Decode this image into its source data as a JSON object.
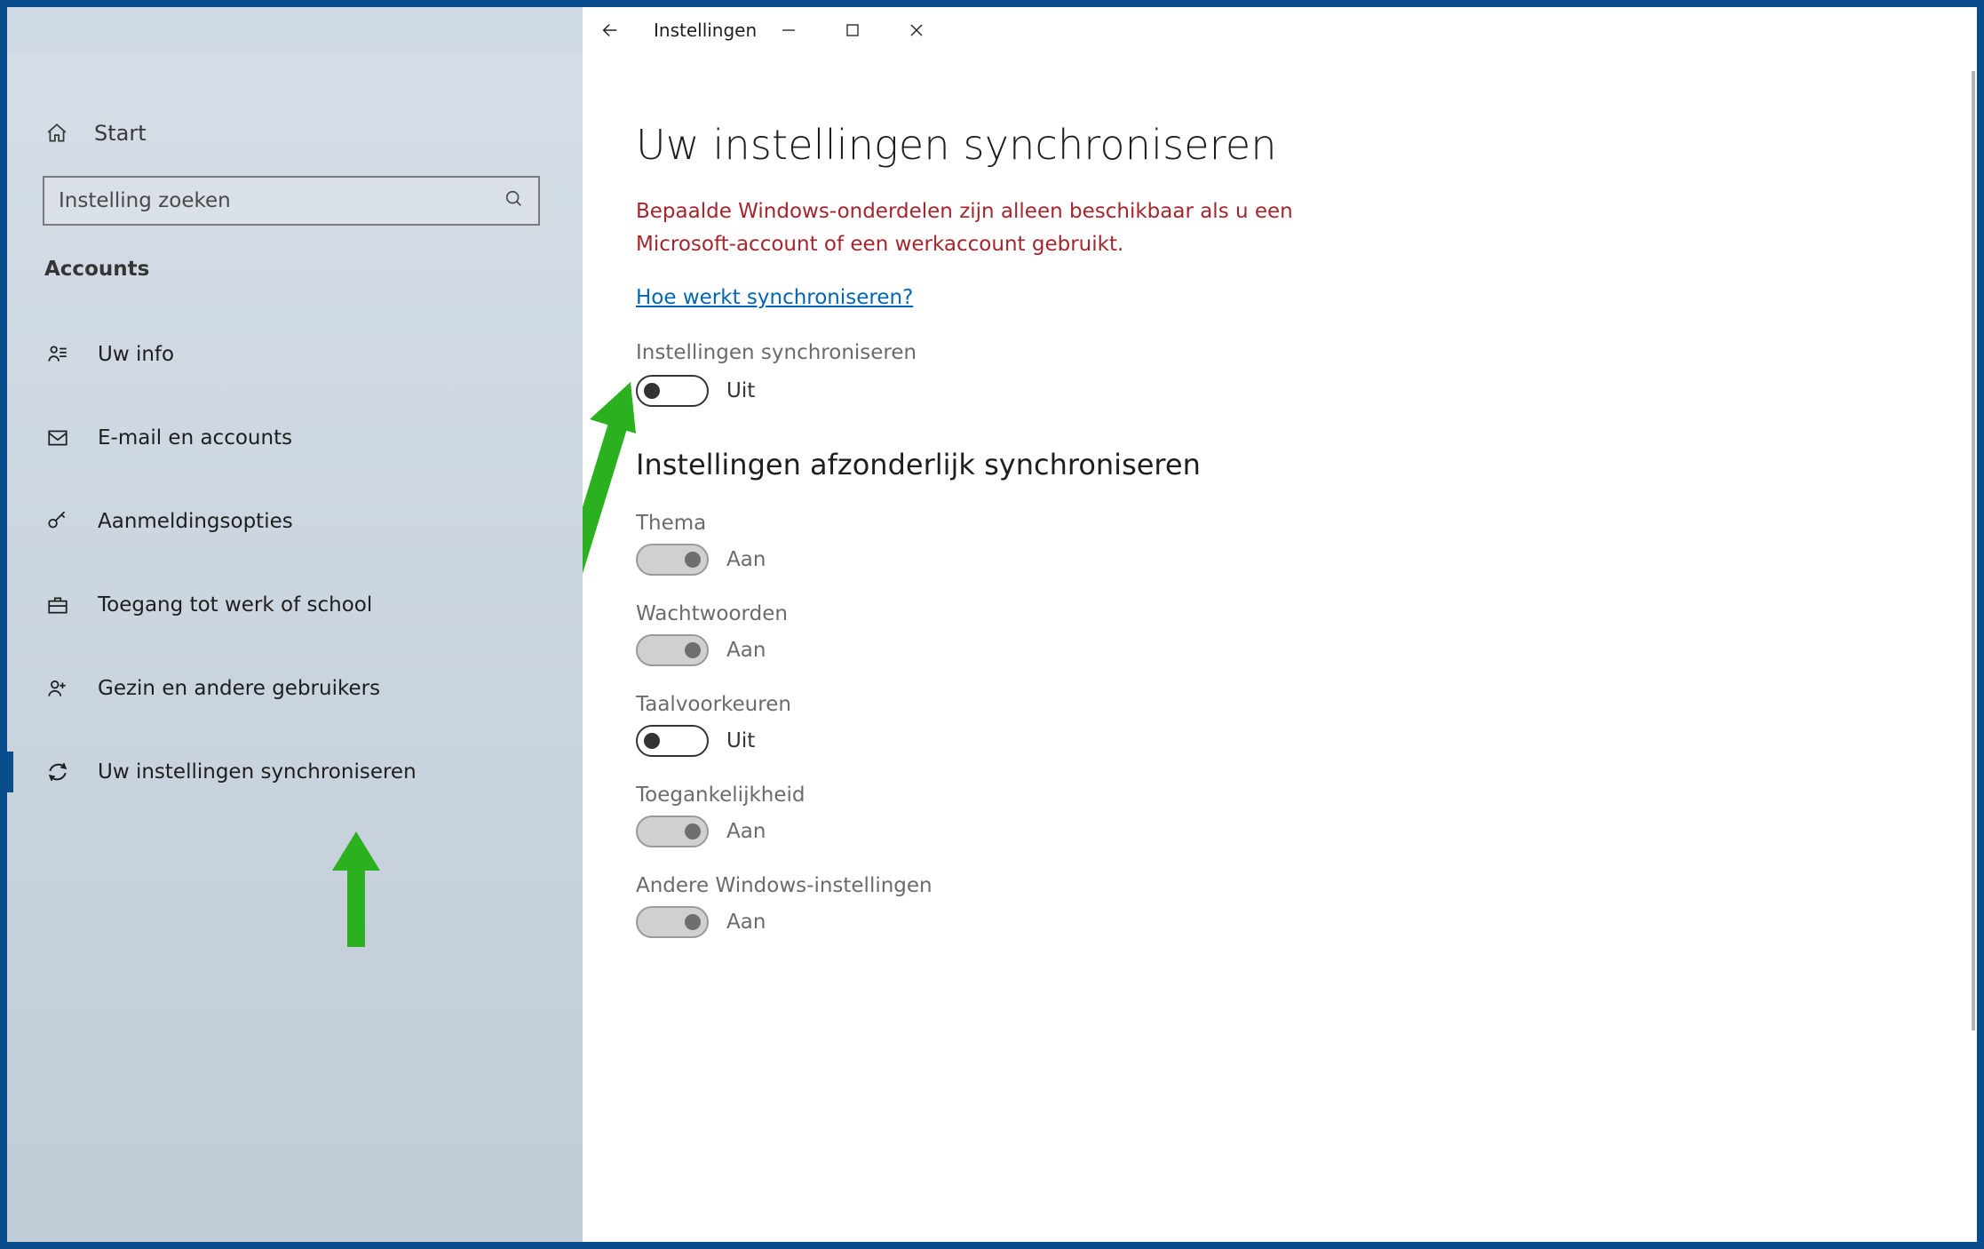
{
  "window": {
    "title": "Instellingen",
    "home_label": "Start",
    "search_placeholder": "Instelling zoeken",
    "section": "Accounts"
  },
  "sidebar": {
    "items": [
      {
        "label": "Uw info",
        "icon": "user-info"
      },
      {
        "label": "E-mail en accounts",
        "icon": "mail"
      },
      {
        "label": "Aanmeldingsopties",
        "icon": "key"
      },
      {
        "label": "Toegang tot werk of school",
        "icon": "briefcase"
      },
      {
        "label": "Gezin en andere gebruikers",
        "icon": "people"
      },
      {
        "label": "Uw instellingen synchroniseren",
        "icon": "sync",
        "selected": true
      }
    ]
  },
  "page": {
    "heading": "Uw instellingen synchroniseren",
    "warning": "Bepaalde Windows-onderdelen zijn alleen beschikbaar als u een Microsoft-account of een werkaccount gebruikt.",
    "help_link": "Hoe werkt synchroniseren?",
    "main_toggle": {
      "label": "Instellingen synchroniseren",
      "state": "Uit",
      "on": false,
      "disabled": false
    },
    "sub_heading": "Instellingen afzonderlijk synchroniseren",
    "settings": [
      {
        "label": "Thema",
        "state": "Aan",
        "on": true,
        "disabled": true
      },
      {
        "label": "Wachtwoorden",
        "state": "Aan",
        "on": true,
        "disabled": true
      },
      {
        "label": "Taalvoorkeuren",
        "state": "Uit",
        "on": false,
        "disabled": false
      },
      {
        "label": "Toegankelijkheid",
        "state": "Aan",
        "on": true,
        "disabled": true
      },
      {
        "label": "Andere Windows-instellingen",
        "state": "Aan",
        "on": true,
        "disabled": true
      }
    ]
  }
}
